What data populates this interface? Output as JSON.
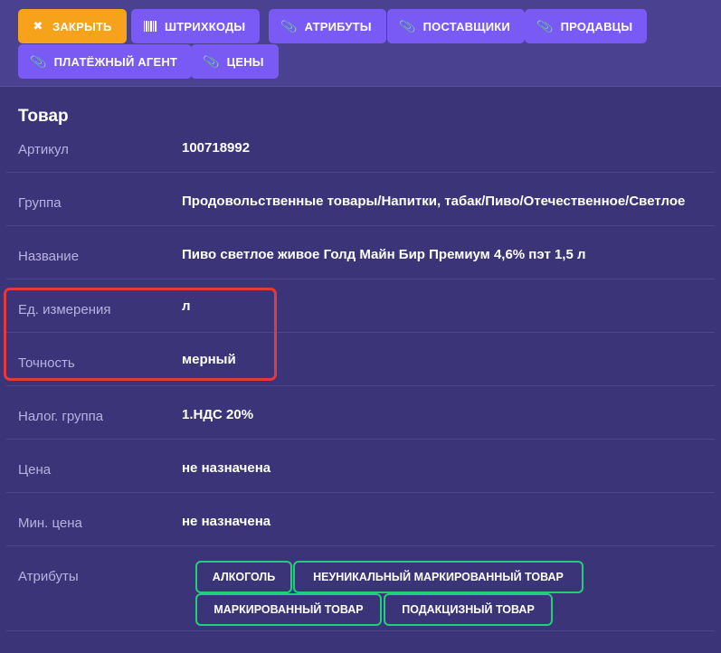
{
  "toolbar": {
    "close": "ЗАКРЫТЬ",
    "barcodes": "ШТРИХКОДЫ",
    "attributes": "АТРИБУТЫ",
    "suppliers": "ПОСТАВЩИКИ",
    "sellers": "ПРОДАВЦЫ",
    "payment_agent": "ПЛАТЁЖНЫЙ АГЕНТ",
    "prices": "ЦЕНЫ"
  },
  "section_title": "Товар",
  "fields": {
    "sku": {
      "label": "Артикул",
      "value": "100718992"
    },
    "group": {
      "label": "Группа",
      "value": "Продовольственные товары/Напитки, табак/Пиво/Отечественное/Светлое"
    },
    "name": {
      "label": "Название",
      "value": "Пиво светлое живое Голд Майн Бир Премиум 4,6% пэт 1,5 л"
    },
    "unit": {
      "label": "Ед. измерения",
      "value": "л"
    },
    "precision": {
      "label": "Точность",
      "value": "мерный"
    },
    "tax_group": {
      "label": "Налог. группа",
      "value": "1.НДС 20%"
    },
    "price": {
      "label": "Цена",
      "value": "не назначена"
    },
    "min_price": {
      "label": "Мин. цена",
      "value": "не назначена"
    },
    "attributes": {
      "label": "Атрибуты"
    }
  },
  "attribute_tags": [
    "АЛКОГОЛЬ",
    "НЕУНИКАЛЬНЫЙ МАРКИРОВАННЫЙ ТОВАР",
    "МАРКИРОВАННЫЙ ТОВАР",
    "ПОДАКЦИЗНЫЙ ТОВАР"
  ],
  "colors": {
    "background": "#3c3478",
    "toolbar": "#4a4290",
    "button": "#7a5af5",
    "close_button": "#f7a21b",
    "tag_border": "#1fcf7c",
    "highlight": "#e03a3a"
  }
}
